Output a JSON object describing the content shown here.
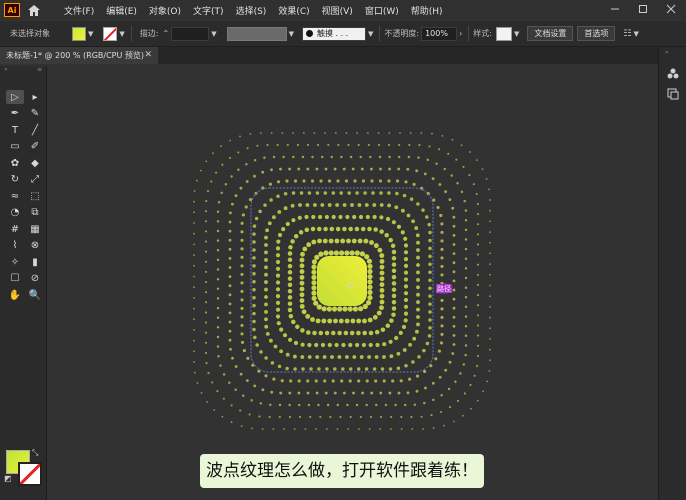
{
  "app": {
    "logo_text": "Ai"
  },
  "menu": [
    "文件(F)",
    "编辑(E)",
    "对象(O)",
    "文字(T)",
    "选择(S)",
    "效果(C)",
    "视图(V)",
    "窗口(W)",
    "帮助(H)"
  ],
  "control_bar": {
    "no_selection": "未选择对象",
    "stroke_label": "描边:",
    "brush_label": "触摸 . . .",
    "opacity_label": "不透明度:",
    "opacity_value": "100%",
    "style_label": "样式:",
    "doc_setup_button": "文档设置",
    "preferences_button": "首选项"
  },
  "document_tab": {
    "title": "未标题-1* @ 200 % (RGB/CPU 预览)"
  },
  "artwork": {
    "label": "路径",
    "dot_color": "#c5d44a",
    "fill_gradient": [
      "#c2de34",
      "#efee39"
    ],
    "selection_color": "#5b7bd0"
  },
  "toolbar": {
    "icons": [
      "selection-icon",
      "direct-selection-icon",
      "pen-icon",
      "curvature-icon",
      "type-icon",
      "line-icon",
      "rectangle-icon",
      "paintbrush-icon",
      "shaper-icon",
      "eraser-icon",
      "rotate-icon",
      "scale-icon",
      "warp-icon",
      "free-transform-icon",
      "shape-builder-icon",
      "perspective-icon",
      "mesh-icon",
      "gradient-icon",
      "eyedropper-icon",
      "blend-icon",
      "symbol-sprayer-icon",
      "column-graph-icon",
      "artboard-icon",
      "slice-icon",
      "hand-icon",
      "zoom-icon"
    ]
  },
  "caption": {
    "text": "波点纹理怎么做，打开软件跟着练！"
  }
}
